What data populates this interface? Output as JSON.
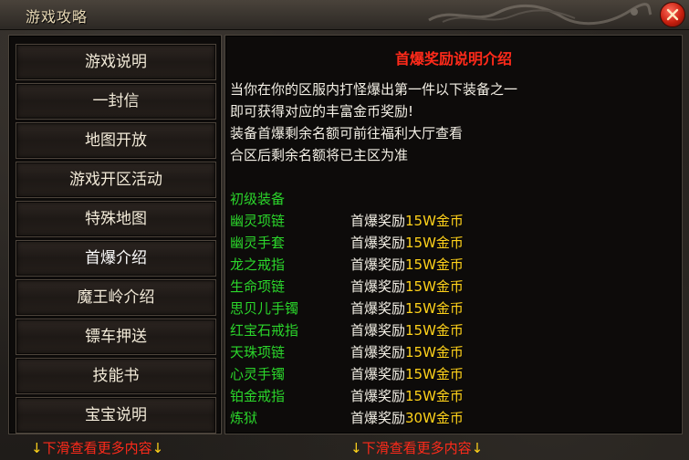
{
  "window": {
    "title": "游戏攻略"
  },
  "menu": {
    "items": [
      {
        "label": "游戏说明"
      },
      {
        "label": "一封信"
      },
      {
        "label": "地图开放"
      },
      {
        "label": "游戏开区活动"
      },
      {
        "label": "特殊地图"
      },
      {
        "label": "首爆介绍"
      },
      {
        "label": "魔王岭介绍"
      },
      {
        "label": "镖车押送"
      },
      {
        "label": "技能书"
      },
      {
        "label": "宝宝说明"
      }
    ]
  },
  "content": {
    "title": "首爆奖励说明介绍",
    "intro": [
      "当你在你的区服内打怪爆出第一件以下装备之一",
      "即可获得对应的丰富金币奖励!",
      "装备首爆剩余名额可前往福利大厅查看",
      "合区后剩余名额将已主区为准"
    ],
    "section_title": "初级装备",
    "reward_prefix": "首爆奖励",
    "items": [
      {
        "name": "幽灵项链",
        "amount": "15W金币"
      },
      {
        "name": "幽灵手套",
        "amount": "15W金币"
      },
      {
        "name": "龙之戒指",
        "amount": "15W金币"
      },
      {
        "name": "生命项链",
        "amount": "15W金币"
      },
      {
        "name": "思贝儿手镯",
        "amount": "15W金币"
      },
      {
        "name": "红宝石戒指",
        "amount": "15W金币"
      },
      {
        "name": "天珠项链",
        "amount": "15W金币"
      },
      {
        "name": "心灵手镯",
        "amount": "15W金币"
      },
      {
        "name": "铂金戒指",
        "amount": "15W金币"
      },
      {
        "name": "炼狱",
        "amount": "30W金币"
      }
    ]
  },
  "footer": {
    "arrow": "↓",
    "hint": "下滑查看更多内容"
  },
  "colors": {
    "title_red": "#ff2a1a",
    "item_green": "#2bd62b",
    "amount_yellow": "#ffd21a",
    "text_white": "#f4f0e6"
  },
  "icons": {
    "close": "close-icon",
    "dragon": "dragon-ornament-icon"
  }
}
